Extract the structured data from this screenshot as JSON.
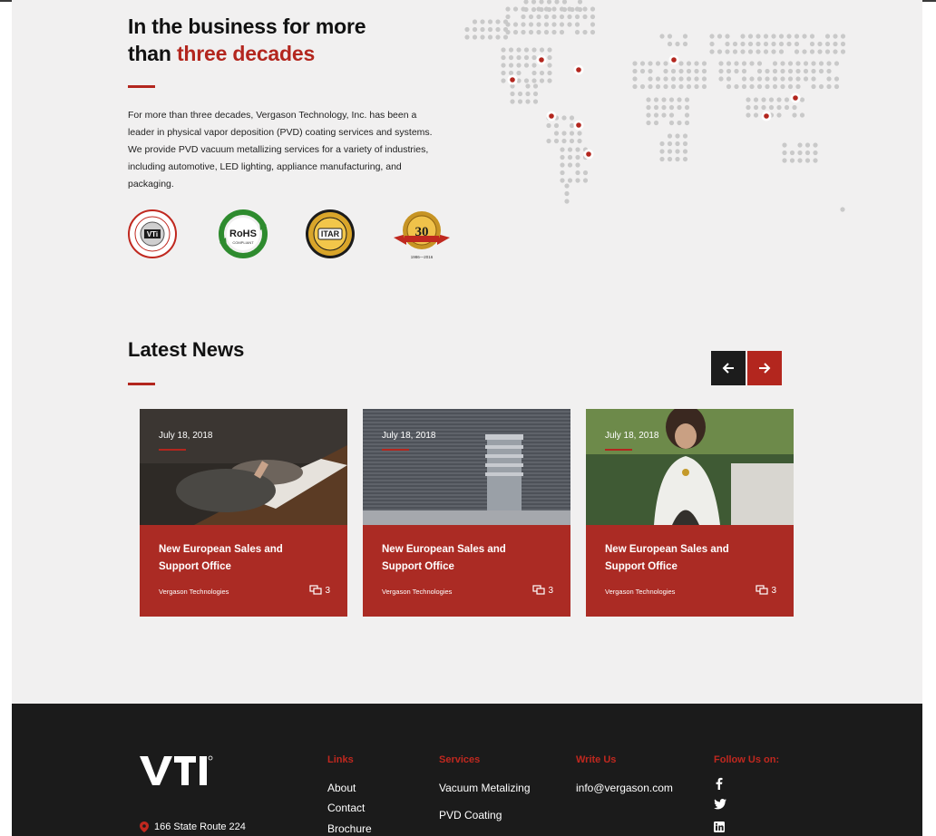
{
  "about": {
    "title_line1": "In the business for more",
    "title_line2_prefix": "than ",
    "title_line2_accent": "three decades",
    "paragraph": "For more than three decades, Vergason Technology, Inc. has been a leader in physical vapor deposition (PVD) coating services and systems. We provide PVD vacuum metallizing services for a variety of industries, including automotive, LED lighting, appliance manufacturing, and packaging.",
    "badges": [
      {
        "name": "vti-certified-badge",
        "text": "VTi"
      },
      {
        "name": "rohs-compliant-badge",
        "text": "RoHS",
        "subtext": "COMPLIANT"
      },
      {
        "name": "itar-badge",
        "text": "ITAR"
      },
      {
        "name": "30-years-badge",
        "text": "30",
        "subtext": "1986—2016"
      }
    ]
  },
  "news": {
    "title": "Latest News",
    "prev_icon": "arrow-left-icon",
    "next_icon": "arrow-right-icon",
    "cards": [
      {
        "date": "July 18, 2018",
        "headline": "New European Sales and Support Office",
        "author": "Vergason Technologies",
        "comments": "3"
      },
      {
        "date": "July 18, 2018",
        "headline": "New European Sales and Support Office",
        "author": "Vergason Technologies",
        "comments": "3"
      },
      {
        "date": "July 18, 2018",
        "headline": "New European Sales and Support Office",
        "author": "Vergason Technologies",
        "comments": "3"
      }
    ]
  },
  "footer": {
    "logo": "VTi",
    "address": "166 State Route 224",
    "links_heading": "Links",
    "links": [
      "About",
      "Contact",
      "Brochure"
    ],
    "services_heading": "Services",
    "services": [
      "Vacuum Metalizing",
      "PVD Coating"
    ],
    "write_heading": "Write Us",
    "email": "info@vergason.com",
    "follow_heading": "Follow Us on:",
    "social": [
      {
        "name": "facebook-icon",
        "glyph": "f"
      },
      {
        "name": "twitter-icon",
        "glyph": "t"
      },
      {
        "name": "linkedin-icon",
        "glyph": "in"
      }
    ]
  },
  "colors": {
    "accent": "#b3261e",
    "card": "#ab2b24",
    "footer": "#1b1b1b",
    "background": "#f1f0f0"
  }
}
